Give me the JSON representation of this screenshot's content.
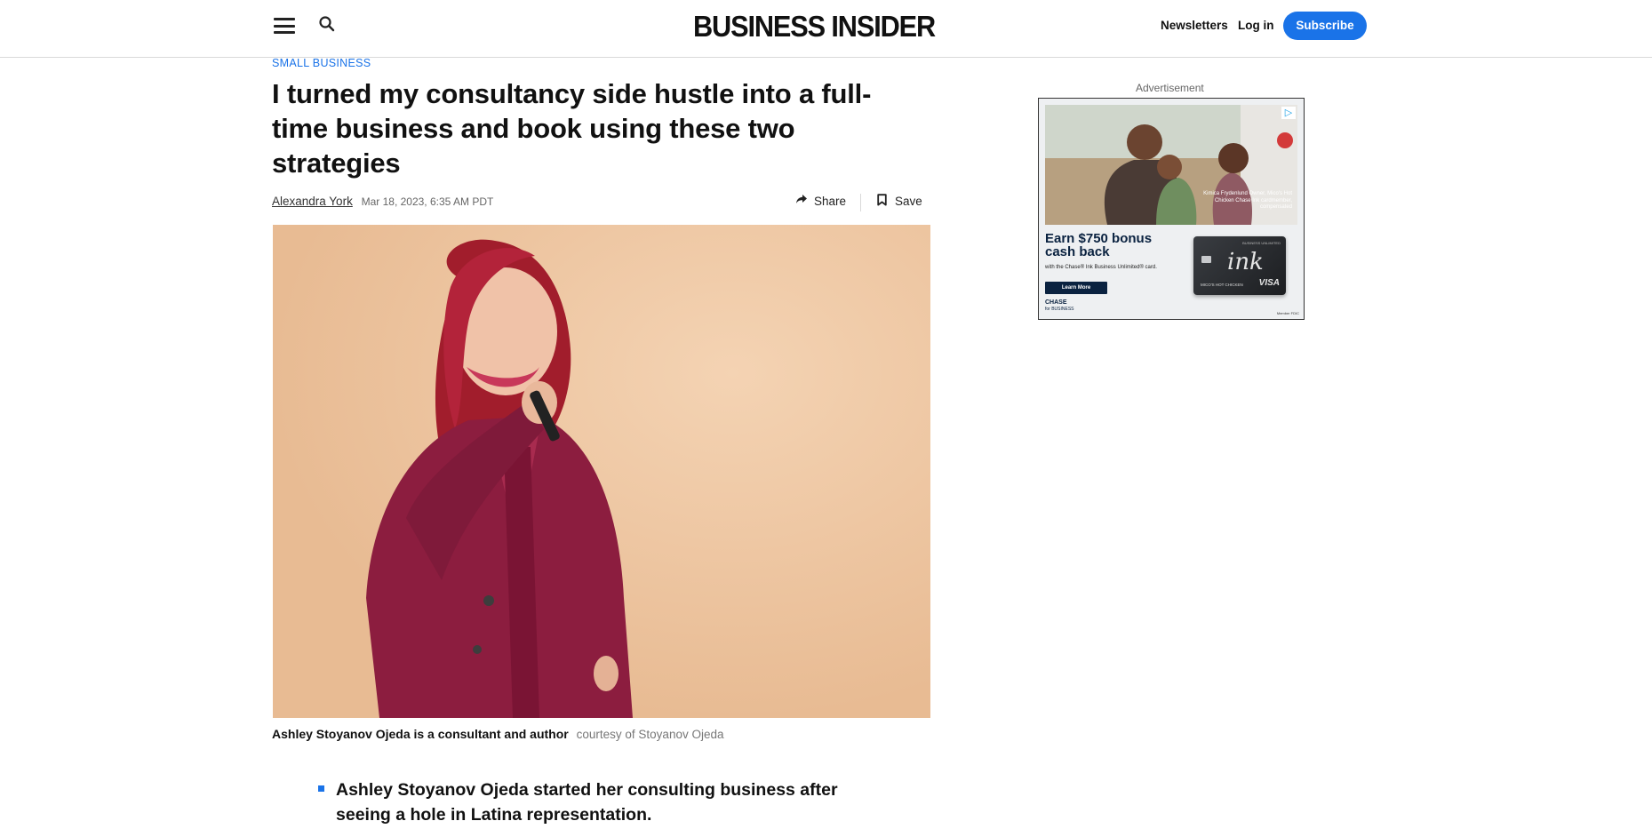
{
  "header": {
    "logo": "BUSINESS INSIDER",
    "newsletters": "Newsletters",
    "login": "Log in",
    "subscribe": "Subscribe"
  },
  "article": {
    "category": "SMALL BUSINESS",
    "headline": "I turned my consultancy side hustle into a full-time business and book using these two strategies",
    "author": "Alexandra York",
    "date": "Mar 18, 2023, 6:35 AM PDT",
    "share_label": "Share",
    "save_label": "Save",
    "caption": "Ashley Stoyanov Ojeda is a consultant and author",
    "credit": "courtesy of Stoyanov Ojeda",
    "bullets": [
      "Ashley Stoyanov Ojeda started her consulting business after seeing a hole in Latina representation."
    ]
  },
  "ad": {
    "label": "Advertisement",
    "photo_text": "Kimica Frydenlund Owner, Mico's Hot Chicken Chase Ink cardmember, compensated",
    "heading": "Earn $750 bonus cash back",
    "subtext": "with the Chase® Ink Business Unlimited® card.",
    "cta": "Learn More",
    "brand": "CHASE",
    "brand_sub": "for BUSINESS",
    "card_top": "BUSINESS UNLIMITED",
    "card_ink": "ink",
    "card_name": "MICO'S HOT CHICKEN",
    "card_network": "VISA",
    "footnote": "Member FDIC"
  },
  "colors": {
    "accent": "#1a73e8",
    "ad_navy": "#0a2240"
  }
}
